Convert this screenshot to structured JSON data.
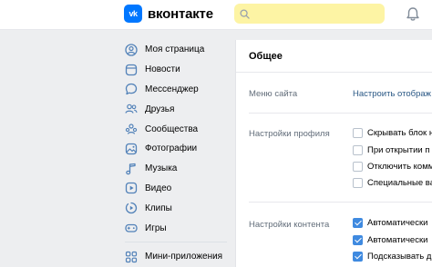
{
  "header": {
    "logo_mark": "vk",
    "logo_text": "вконтакте",
    "search_placeholder": "",
    "search_icon": "search-icon",
    "bell_icon": "bell-icon",
    "accent": "#0077ff",
    "search_bg": "#fdf4a4"
  },
  "sidebar": {
    "items": [
      {
        "label": "Моя страница",
        "icon": "user-circle-icon"
      },
      {
        "label": "Новости",
        "icon": "news-icon"
      },
      {
        "label": "Мессенджер",
        "icon": "chat-bubble-icon"
      },
      {
        "label": "Друзья",
        "icon": "friends-icon"
      },
      {
        "label": "Сообщества",
        "icon": "communities-icon"
      },
      {
        "label": "Фотографии",
        "icon": "photo-icon"
      },
      {
        "label": "Музыка",
        "icon": "music-note-icon"
      },
      {
        "label": "Видео",
        "icon": "video-icon"
      },
      {
        "label": "Клипы",
        "icon": "clips-icon"
      },
      {
        "label": "Игры",
        "icon": "gamepad-icon"
      }
    ],
    "extra_items": [
      {
        "label": "Мини-приложения",
        "icon": "mini-apps-icon"
      }
    ]
  },
  "settings": {
    "title": "Общее",
    "menu_label": "Меню сайта",
    "menu_link": "Настроить отображ",
    "profile_label": "Настройки профиля",
    "profile_options": [
      {
        "label": "Скрывать блок н",
        "checked": false
      },
      {
        "label": "При открытии п",
        "checked": false
      },
      {
        "label": "Отключить комм",
        "checked": false
      },
      {
        "label": "Специальные ва",
        "checked": false
      }
    ],
    "content_label": "Настройки контента",
    "content_options": [
      {
        "label": "Автоматически",
        "checked": true
      },
      {
        "label": "Автоматически",
        "checked": true
      },
      {
        "label": "Подсказывать д",
        "checked": true
      }
    ]
  }
}
